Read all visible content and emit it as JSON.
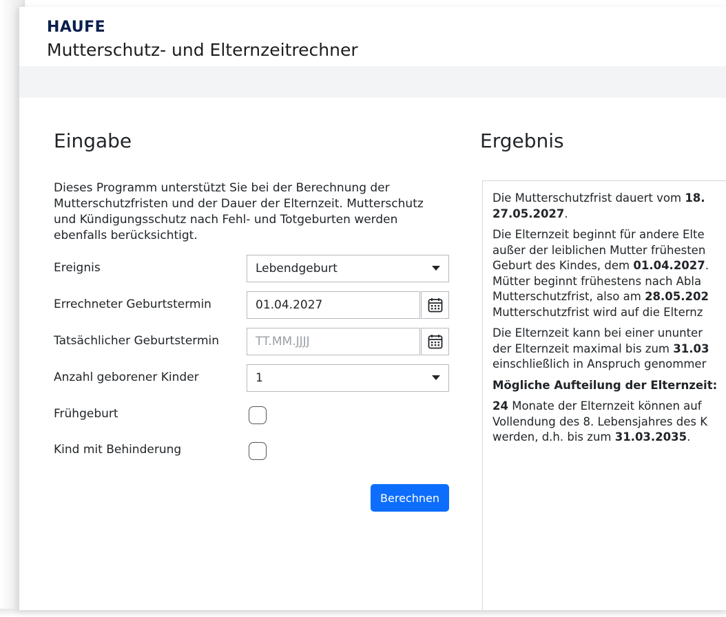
{
  "header": {
    "brand": "HAUFE",
    "title": "Mutterschutz- und Elternzeitrechner"
  },
  "input": {
    "heading": "Eingabe",
    "intro": "Dieses Programm unterstützt Sie bei der Berechnung der Mutterschutzfristen und der Dauer der Elternzeit. Mutterschutz und Kündigungsschutz nach Fehl- und Totgeburten werden ebenfalls berücksichtigt.",
    "event_label": "Ereignis",
    "event_value": "Lebendgeburt",
    "calc_birth_label": "Errechneter Geburtstermin",
    "calc_birth_value": "01.04.2027",
    "actual_birth_label": "Tatsächlicher Geburtstermin",
    "actual_birth_placeholder": "TT.MM.JJJJ",
    "children_label": "Anzahl geborener Kinder",
    "children_value": "1",
    "premature_label": "Frühgeburt",
    "disability_label": "Kind mit Behinderung",
    "submit_label": "Berechnen"
  },
  "result": {
    "heading": "Ergebnis",
    "p1a": "Die Mutterschutzfrist dauert vom ",
    "p1b": "18.",
    "p1c": "27.05.2027",
    "p1d": ".",
    "p2a": "Die Elternzeit beginnt für andere Elte",
    "p2b": "außer der leiblichen Mutter frühesten",
    "p2c": "Geburt des Kindes, dem ",
    "p2d": "01.04.2027",
    "p2e": ".",
    "p2f": "Mütter beginnt frühestens nach Abla",
    "p2g": "Mutterschutzfrist, also am ",
    "p2h": "28.05.202",
    "p2i": "Mutterschutzfrist wird auf die Elternz",
    "p3a": "Die Elternzeit kann bei einer ununter",
    "p3b": "der Elternzeit maximal bis zum ",
    "p3c": "31.03",
    "p3d": "einschließlich in Anspruch genommer",
    "p4": "Mögliche Aufteilung der Elternzeit:",
    "p5a": "24",
    "p5b": " Monate der Elternzeit können auf",
    "p5c": "Vollendung des 8. Lebensjahres des K",
    "p5d": "werden, d.h. bis zum ",
    "p5e": "31.03.2035",
    "p5f": "."
  }
}
